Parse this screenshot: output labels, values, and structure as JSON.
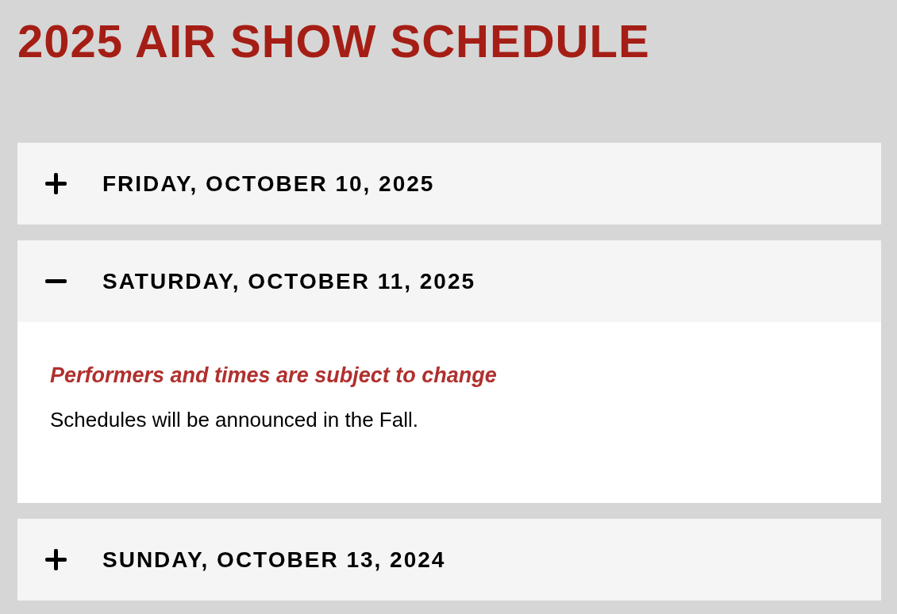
{
  "page": {
    "title": "2025 AIR SHOW SCHEDULE"
  },
  "days": [
    {
      "label": "FRIDAY, OCTOBER 10, 2025",
      "expanded": false
    },
    {
      "label": "SATURDAY, OCTOBER 11, 2025",
      "expanded": true,
      "notice": "Performers and times are subject to change",
      "body": "Schedules will be announced in the Fall."
    },
    {
      "label": "SUNDAY, OCTOBER 13, 2024",
      "expanded": false
    }
  ]
}
